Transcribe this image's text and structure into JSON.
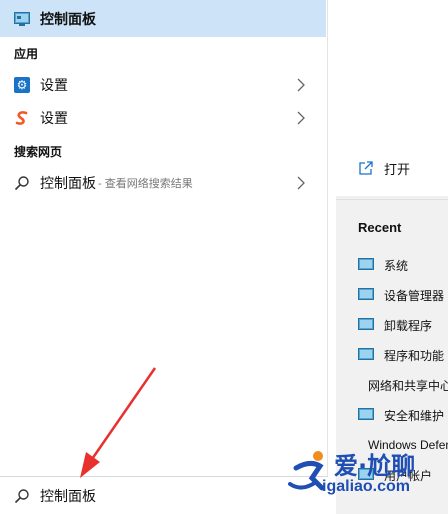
{
  "best_match": {
    "label": "控制面板",
    "icon": "control-panel-icon"
  },
  "apps": {
    "header": "应用",
    "items": [
      {
        "label": "设置",
        "icon": "gear-icon"
      },
      {
        "label": "设置",
        "icon": "sogou-icon"
      }
    ]
  },
  "web": {
    "header": "搜索网页",
    "item": {
      "label": "控制面板",
      "suffix": " - 查看网络搜索结果",
      "icon": "search-icon"
    }
  },
  "search": {
    "value": "控制面板",
    "icon": "search-icon"
  },
  "preview": {
    "open_label": "打开",
    "recent_title": "Recent",
    "recent": [
      "系统",
      "设备管理器",
      "卸载程序",
      "程序和功能",
      "网络和共享中心",
      "安全和维护",
      "Windows Defender",
      "用户帐户"
    ]
  },
  "watermark": {
    "brand": "爱·尬聊",
    "url": "igaliao.com"
  },
  "colors": {
    "highlight": "#cde3f7",
    "arrow": "#e8302f",
    "accent": "#1a73c8"
  }
}
